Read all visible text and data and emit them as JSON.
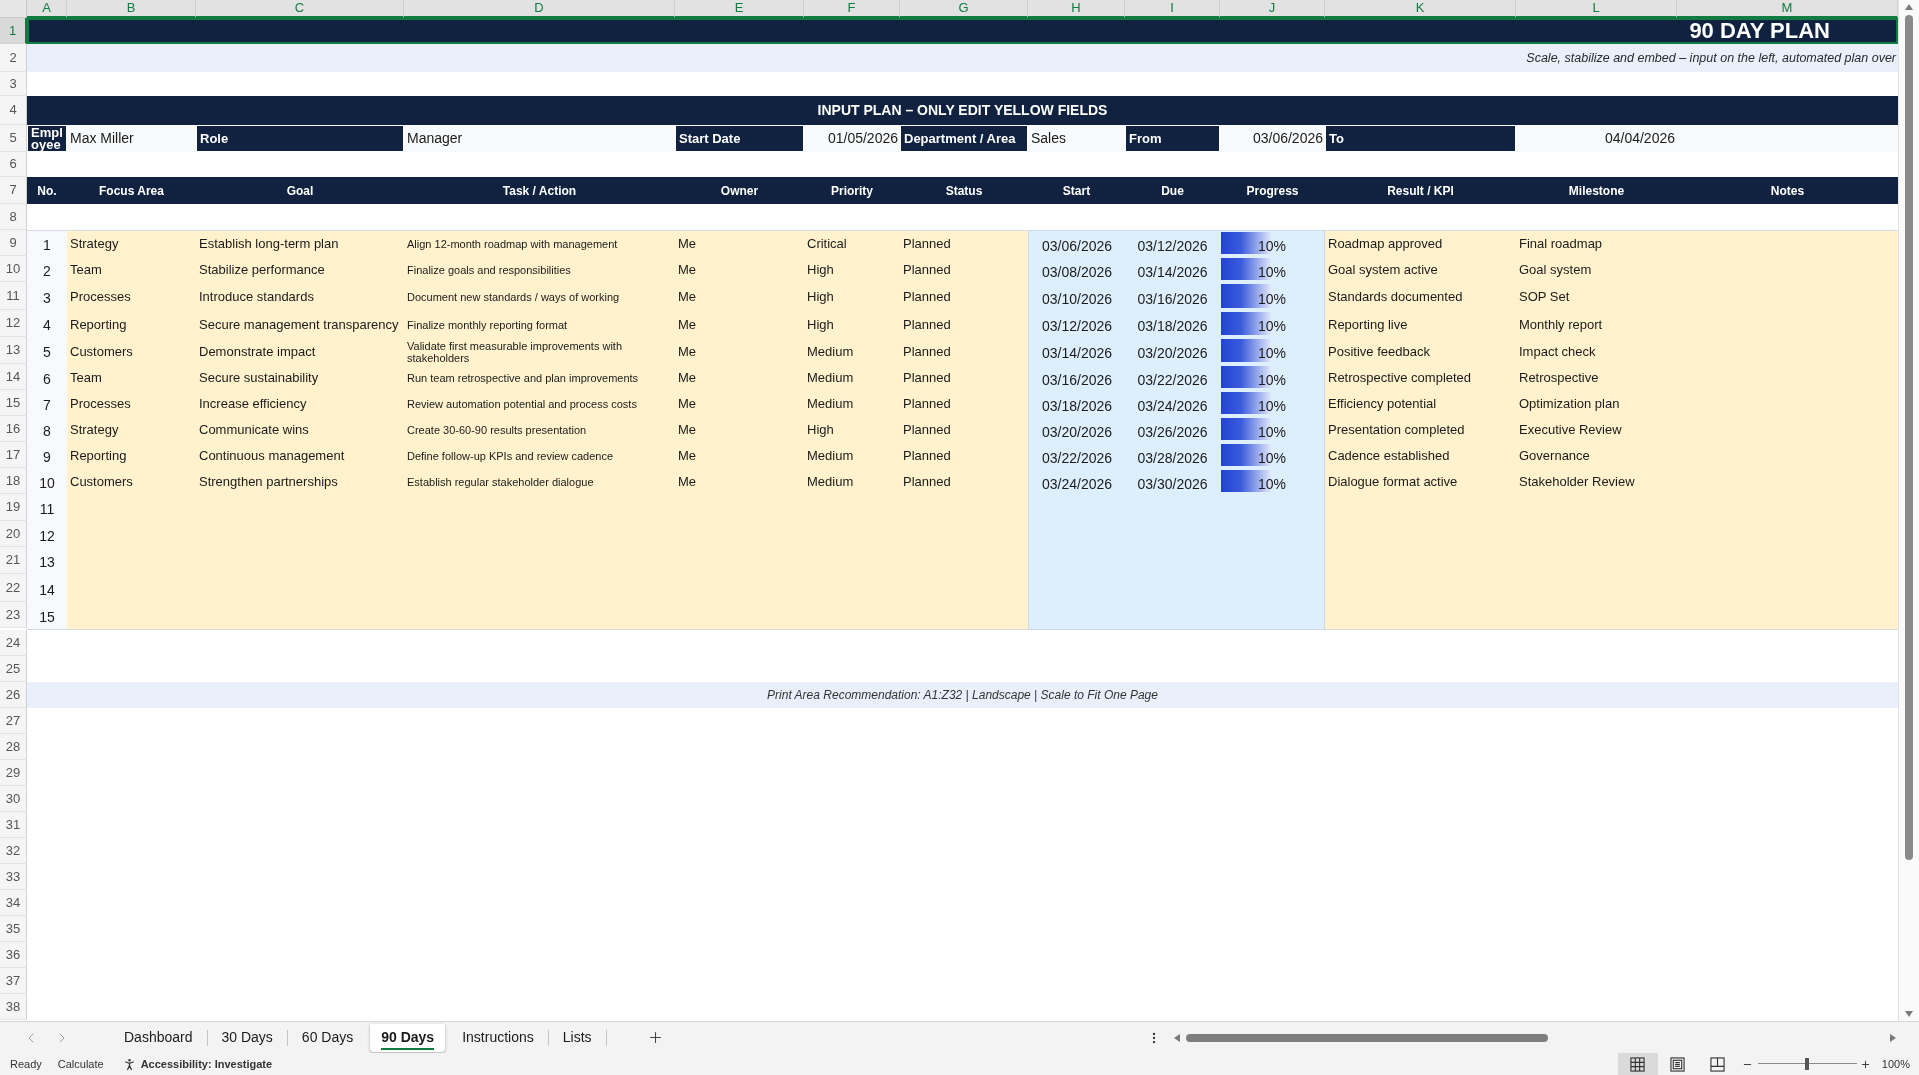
{
  "column_headers": [
    {
      "label": "A",
      "selected": true
    },
    {
      "label": "B",
      "selected": true
    },
    {
      "label": "C",
      "selected": true
    },
    {
      "label": "D",
      "selected": true
    },
    {
      "label": "E",
      "selected": true
    },
    {
      "label": "F",
      "selected": true
    },
    {
      "label": "G",
      "selected": true
    },
    {
      "label": "H",
      "selected": true
    },
    {
      "label": "I",
      "selected": true
    },
    {
      "label": "J",
      "selected": true
    },
    {
      "label": "K",
      "selected": true
    },
    {
      "label": "L",
      "selected": true
    },
    {
      "label": "M",
      "selected": true
    }
  ],
  "row_headers": [
    {
      "label": "1",
      "selected": true
    },
    {
      "label": "2",
      "selected": false
    },
    {
      "label": "3",
      "selected": false
    },
    {
      "label": "4",
      "selected": false
    },
    {
      "label": "5",
      "selected": false
    },
    {
      "label": "6",
      "selected": false
    },
    {
      "label": "7",
      "selected": false
    },
    {
      "label": "8",
      "selected": false
    },
    {
      "label": "9",
      "selected": false
    },
    {
      "label": "10",
      "selected": false
    },
    {
      "label": "11",
      "selected": false
    },
    {
      "label": "12",
      "selected": false
    },
    {
      "label": "13",
      "selected": false
    },
    {
      "label": "14",
      "selected": false
    },
    {
      "label": "15",
      "selected": false
    },
    {
      "label": "16",
      "selected": false
    },
    {
      "label": "17",
      "selected": false
    },
    {
      "label": "18",
      "selected": false
    },
    {
      "label": "19",
      "selected": false
    },
    {
      "label": "20",
      "selected": false
    },
    {
      "label": "21",
      "selected": false
    },
    {
      "label": "22",
      "selected": false
    },
    {
      "label": "23",
      "selected": false
    },
    {
      "label": "24",
      "selected": false
    },
    {
      "label": "25",
      "selected": false
    },
    {
      "label": "26",
      "selected": false
    },
    {
      "label": "27",
      "selected": false
    },
    {
      "label": "28",
      "selected": false
    },
    {
      "label": "29",
      "selected": false
    },
    {
      "label": "30",
      "selected": false
    },
    {
      "label": "31",
      "selected": false
    },
    {
      "label": "32",
      "selected": false
    },
    {
      "label": "33",
      "selected": false
    },
    {
      "label": "34",
      "selected": false
    },
    {
      "label": "35",
      "selected": false
    },
    {
      "label": "36",
      "selected": false
    },
    {
      "label": "37",
      "selected": false
    },
    {
      "label": "38",
      "selected": false
    }
  ],
  "title": {
    "text": "90 DAY PLAN",
    "selected": true
  },
  "subtitle": "Scale, stabilize and embed – input on the left, automated plan over",
  "input_banner": "INPUT PLAN – ONLY EDIT YELLOW FIELDS",
  "info_fields": [
    {
      "kind": "label",
      "text": "Employee"
    },
    {
      "kind": "value",
      "text": "Max Miller"
    },
    {
      "kind": "label",
      "text": "Role"
    },
    {
      "kind": "value",
      "text": "Manager"
    },
    {
      "kind": "label",
      "text": "Start Date"
    },
    {
      "kind": "date",
      "text": "01/05/2026"
    },
    {
      "kind": "label",
      "text": "Department / Area"
    },
    {
      "kind": "value",
      "text": "Sales"
    },
    {
      "kind": "label",
      "text": "From"
    },
    {
      "kind": "date",
      "text": "03/06/2026"
    },
    {
      "kind": "label",
      "text": "To"
    },
    {
      "kind": "date",
      "text": "04/04/2026"
    }
  ],
  "table": {
    "columns": [
      "No.",
      "Focus Area",
      "Goal",
      "Task / Action",
      "Owner",
      "Priority",
      "Status",
      "Start",
      "Due",
      "Progress",
      "Result / KPI",
      "Milestone",
      "Notes"
    ],
    "rows": [
      {
        "no": "1",
        "focus_area": "Strategy",
        "goal": "Establish long-term plan",
        "task": "Align 12-month roadmap with management",
        "owner": "Me",
        "priority": "Critical",
        "status": "Planned",
        "start": "03/06/2026",
        "due": "03/12/2026",
        "progress": {
          "level": 0.48,
          "reading": "10%"
        },
        "result_kpi": "Roadmap approved",
        "milestone": "Final roadmap"
      },
      {
        "no": "2",
        "focus_area": "Team",
        "goal": "Stabilize performance",
        "task": "Finalize goals and responsibilities",
        "owner": "Me",
        "priority": "High",
        "status": "Planned",
        "start": "03/08/2026",
        "due": "03/14/2026",
        "progress": {
          "level": 0.48,
          "reading": "10%"
        },
        "result_kpi": "Goal system active",
        "milestone": "Goal system"
      },
      {
        "no": "3",
        "focus_area": "Processes",
        "goal": "Introduce standards",
        "task": "Document new standards / ways of working",
        "owner": "Me",
        "priority": "High",
        "status": "Planned",
        "start": "03/10/2026",
        "due": "03/16/2026",
        "progress": {
          "level": 0.48,
          "reading": "10%"
        },
        "result_kpi": "Standards documented",
        "milestone": "SOP Set"
      },
      {
        "no": "4",
        "focus_area": "Reporting",
        "goal": "Secure management transparency",
        "task": "Finalize monthly reporting format",
        "owner": "Me",
        "priority": "High",
        "status": "Planned",
        "start": "03/12/2026",
        "due": "03/18/2026",
        "progress": {
          "level": 0.48,
          "reading": "10%"
        },
        "result_kpi": "Reporting live",
        "milestone": "Monthly report"
      },
      {
        "no": "5",
        "focus_area": "Customers",
        "goal": "Demonstrate impact",
        "task": "Validate first measurable improvements with stakeholders",
        "owner": "Me",
        "priority": "Medium",
        "status": "Planned",
        "start": "03/14/2026",
        "due": "03/20/2026",
        "progress": {
          "level": 0.48,
          "reading": "10%"
        },
        "result_kpi": "Positive feedback",
        "milestone": "Impact check"
      },
      {
        "no": "6",
        "focus_area": "Team",
        "goal": "Secure sustainability",
        "task": "Run team retrospective and plan improvements",
        "owner": "Me",
        "priority": "Medium",
        "status": "Planned",
        "start": "03/16/2026",
        "due": "03/22/2026",
        "progress": {
          "level": 0.48,
          "reading": "10%"
        },
        "result_kpi": "Retrospective completed",
        "milestone": "Retrospective"
      },
      {
        "no": "7",
        "focus_area": "Processes",
        "goal": "Increase efficiency",
        "task": "Review automation potential and process costs",
        "owner": "Me",
        "priority": "Medium",
        "status": "Planned",
        "start": "03/18/2026",
        "due": "03/24/2026",
        "progress": {
          "level": 0.48,
          "reading": "10%"
        },
        "result_kpi": "Efficiency potential",
        "milestone": "Optimization plan"
      },
      {
        "no": "8",
        "focus_area": "Strategy",
        "goal": "Communicate wins",
        "task": "Create 30-60-90 results presentation",
        "owner": "Me",
        "priority": "High",
        "status": "Planned",
        "start": "03/20/2026",
        "due": "03/26/2026",
        "progress": {
          "level": 0.48,
          "reading": "10%"
        },
        "result_kpi": "Presentation completed",
        "milestone": "Executive Review"
      },
      {
        "no": "9",
        "focus_area": "Reporting",
        "goal": "Continuous management",
        "task": "Define follow-up KPIs and review cadence",
        "owner": "Me",
        "priority": "Medium",
        "status": "Planned",
        "start": "03/22/2026",
        "due": "03/28/2026",
        "progress": {
          "level": 0.48,
          "reading": "10%"
        },
        "result_kpi": "Cadence established",
        "milestone": "Governance"
      },
      {
        "no": "10",
        "focus_area": "Customers",
        "goal": "Strengthen partnerships",
        "task": "Establish regular stakeholder dialogue",
        "owner": "Me",
        "priority": "Medium",
        "status": "Planned",
        "start": "03/24/2026",
        "due": "03/30/2026",
        "progress": {
          "level": 0.48,
          "reading": "10%"
        },
        "result_kpi": "Dialogue format active",
        "milestone": "Stakeholder Review"
      },
      {
        "no": "11"
      },
      {
        "no": "12"
      },
      {
        "no": "13"
      },
      {
        "no": "14"
      },
      {
        "no": "15"
      }
    ]
  },
  "print_note": "Print Area Recommendation: A1:Z32 | Landscape | Scale to Fit One Page",
  "sheet_tabs": [
    {
      "label": "Dashboard",
      "selected": false
    },
    {
      "label": "30 Days",
      "selected": false
    },
    {
      "label": "60 Days",
      "selected": false
    },
    {
      "label": "90 Days",
      "selected": true
    },
    {
      "label": "Instructions",
      "selected": false
    },
    {
      "label": "Lists",
      "selected": false
    }
  ],
  "status_bar": {
    "mode": "Ready",
    "calculate": "Calculate",
    "accessibility": "Accessibility: Investigate",
    "views": [
      {
        "kind": "normal",
        "selected": true
      },
      {
        "kind": "page_layout",
        "selected": false
      },
      {
        "kind": "page_break_preview",
        "selected": false
      }
    ],
    "zoom": {
      "level": 0.5,
      "reading": "100%"
    }
  }
}
